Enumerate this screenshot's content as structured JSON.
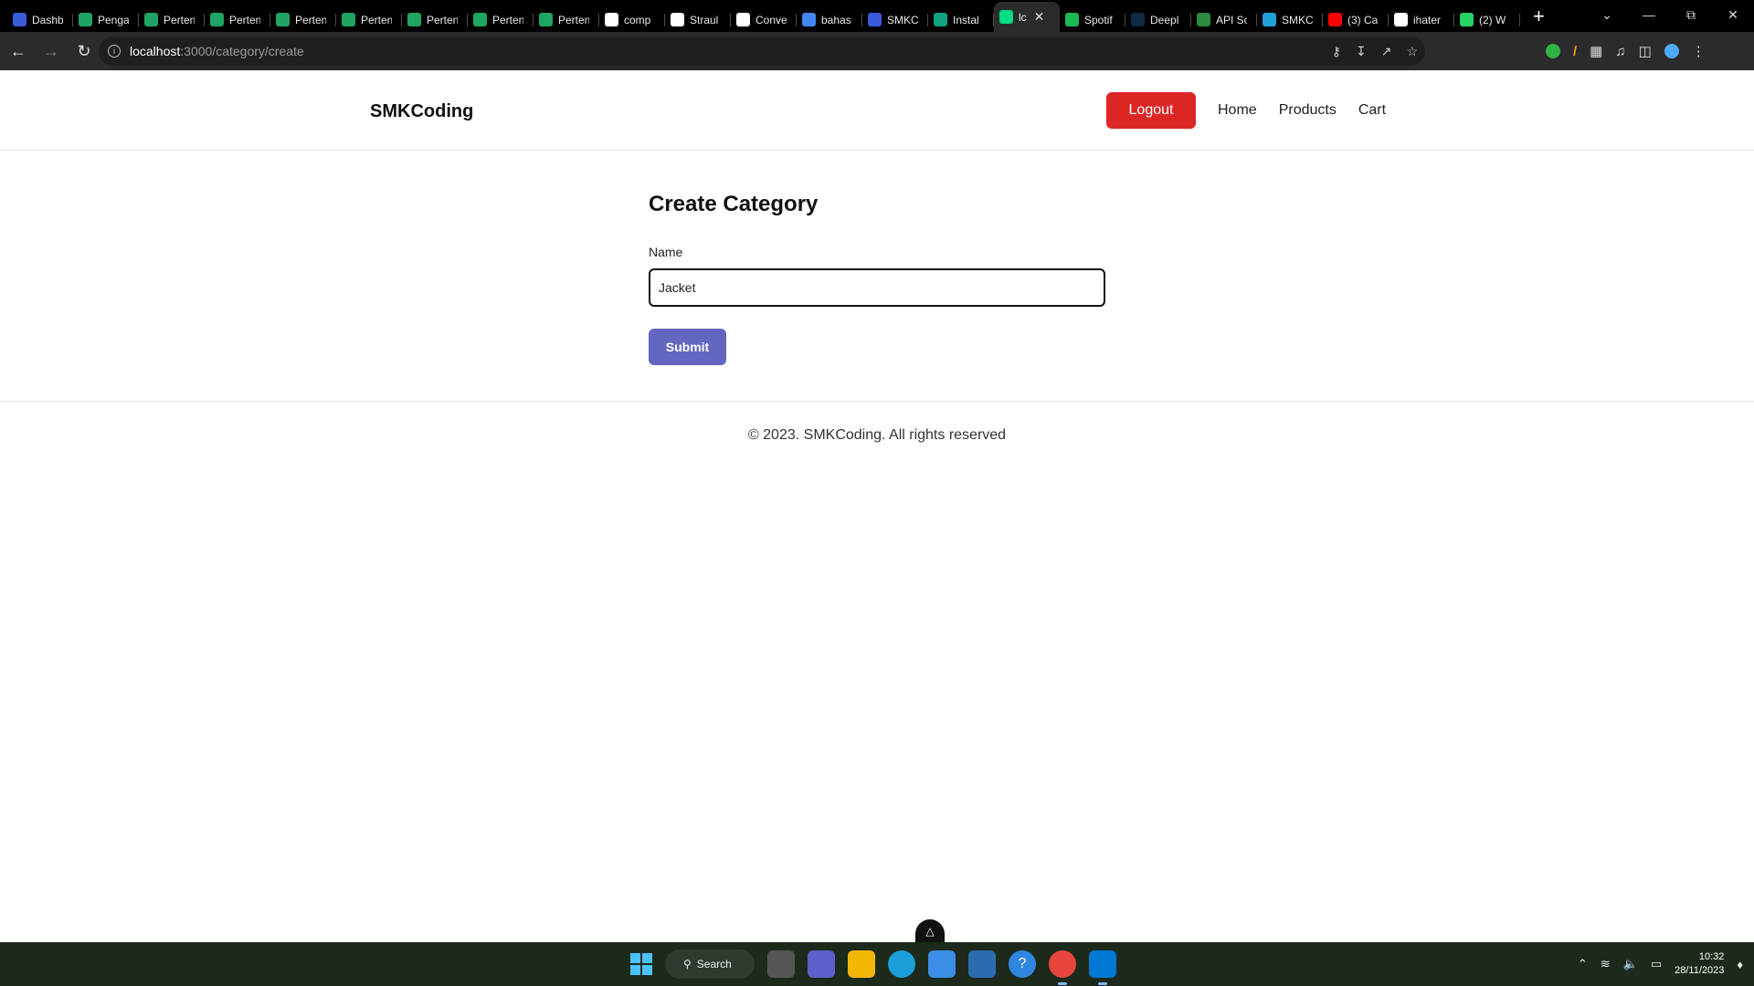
{
  "browser": {
    "tabs": [
      {
        "title": "Dashb",
        "icon": "shield-icon",
        "color": "#3b5bdb"
      },
      {
        "title": "Penga",
        "icon": "drive-icon",
        "color": "#1fa463"
      },
      {
        "title": "Perten",
        "icon": "drive-icon",
        "color": "#1fa463"
      },
      {
        "title": "Perten",
        "icon": "drive-icon",
        "color": "#1fa463"
      },
      {
        "title": "Perten",
        "icon": "drive-icon",
        "color": "#1fa463"
      },
      {
        "title": "Perten",
        "icon": "drive-icon",
        "color": "#1fa463"
      },
      {
        "title": "Perten",
        "icon": "drive-icon",
        "color": "#1fa463"
      },
      {
        "title": "Perten",
        "icon": "drive-icon",
        "color": "#1fa463"
      },
      {
        "title": "Perten",
        "icon": "drive-icon",
        "color": "#1fa463"
      },
      {
        "title": "comp",
        "icon": "notion-icon",
        "color": "#ffffff"
      },
      {
        "title": "Straul",
        "icon": "github-icon",
        "color": "#ffffff"
      },
      {
        "title": "Conve",
        "icon": "cc-icon",
        "color": "#ffffff"
      },
      {
        "title": "bahas",
        "icon": "google-icon",
        "color": "#4285f4"
      },
      {
        "title": "SMKC",
        "icon": "shield-icon",
        "color": "#3b5bdb"
      },
      {
        "title": "Instal",
        "icon": "openai-icon",
        "color": "#10a37f"
      },
      {
        "title": "lc",
        "icon": "nuxt-icon",
        "color": "#00dc82",
        "active": true
      },
      {
        "title": "Spotif",
        "icon": "spotify-icon",
        "color": "#1db954"
      },
      {
        "title": "Deepl",
        "icon": "deepl-icon",
        "color": "#0f2b46"
      },
      {
        "title": "API Sc",
        "icon": "api-icon",
        "color": "#2b8a3e"
      },
      {
        "title": "SMKC",
        "icon": "telegram-icon",
        "color": "#229ed9"
      },
      {
        "title": "(3) Ca",
        "icon": "youtube-icon",
        "color": "#ff0000"
      },
      {
        "title": "ihater",
        "icon": "github-icon",
        "color": "#ffffff"
      },
      {
        "title": "(2) W",
        "icon": "whatsapp-icon",
        "color": "#25d366"
      }
    ],
    "url_host": "localhost",
    "url_path": ":3000/category/create"
  },
  "header": {
    "brand": "SMKCoding",
    "logout_label": "Logout",
    "nav": [
      "Home",
      "Products",
      "Cart"
    ]
  },
  "form": {
    "title": "Create Category",
    "name_label": "Name",
    "name_value": "Jacket",
    "submit_label": "Submit"
  },
  "footer": {
    "copyright": "© 2023. SMKCoding. All rights reserved"
  },
  "taskbar": {
    "search_label": "Search",
    "time": "10:32",
    "date": "28/11/2023"
  },
  "colors": {
    "logout": "#dc2626",
    "submit": "#6366c1"
  }
}
